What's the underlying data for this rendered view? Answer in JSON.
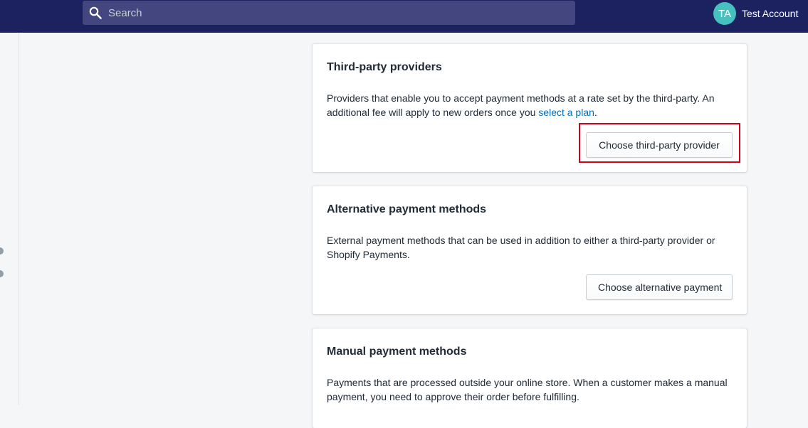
{
  "header": {
    "search": {
      "placeholder": "Search",
      "value": ""
    },
    "account": {
      "initials": "TA",
      "name": "Test Account"
    }
  },
  "cards": [
    {
      "title": "Third-party providers",
      "text_before_link": "Providers that enable you to accept payment methods at a rate set by the third-party. An additional fee will apply to new orders once you ",
      "link_text": "select a plan",
      "text_after_link": ".",
      "button_label": "Choose third-party provider"
    },
    {
      "title": "Alternative payment methods",
      "text": "External payment methods that can be used in addition to either a third-party provider or Shopify Payments.",
      "button_label": "Choose alternative payment"
    },
    {
      "title": "Manual payment methods",
      "text": "Payments that are processed outside your online store. When a customer makes a manual payment, you need to approve their order before fulfilling."
    }
  ],
  "colors": {
    "topbar": "#1c2260",
    "search_bg": "#43467f",
    "avatar": "#47c1bf",
    "link": "#006fbb",
    "highlight": "#d0021b"
  }
}
